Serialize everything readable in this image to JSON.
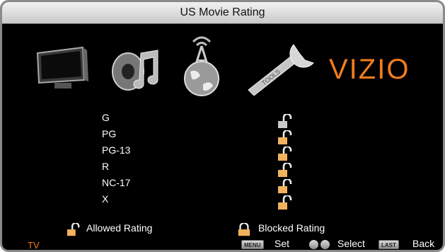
{
  "title": "US Movie Rating",
  "brand": "VIZIO",
  "menu_icons": [
    "tv-icon",
    "music-icon",
    "network-icon",
    "tools-icon"
  ],
  "ratings": [
    {
      "label": "G",
      "state": "allowed"
    },
    {
      "label": "PG",
      "state": "allowed"
    },
    {
      "label": "PG-13",
      "state": "allowed"
    },
    {
      "label": "R",
      "state": "allowed"
    },
    {
      "label": "NC-17",
      "state": "allowed"
    },
    {
      "label": "X",
      "state": "allowed"
    }
  ],
  "legend": {
    "allowed": "Allowed Rating",
    "blocked": "Blocked Rating"
  },
  "footer": {
    "source": "TV",
    "menu_key": "MENU",
    "set": "Set",
    "select": "Select",
    "last_key": "LAST",
    "back": "Back"
  },
  "colors": {
    "accent": "#f07d1c",
    "background": "#000000",
    "lock_gold": "#f2b25c"
  }
}
